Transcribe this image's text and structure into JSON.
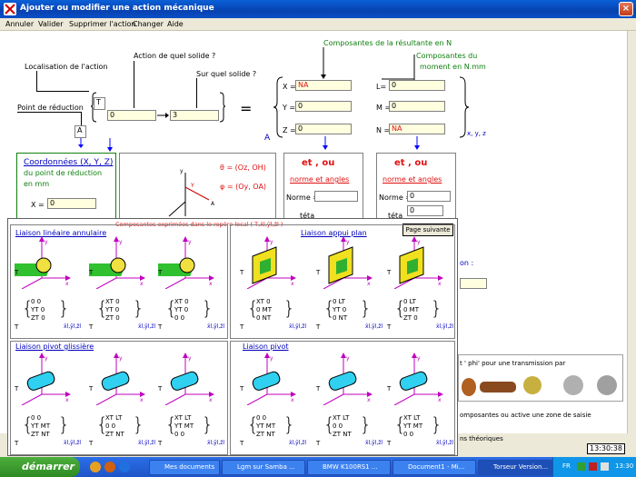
{
  "window": {
    "title": "Ajouter ou modifier une action mécanique"
  },
  "menu": [
    "Annuler",
    "Valider",
    "Supprimer l'action",
    "Changer",
    "Aide"
  ],
  "labels": {
    "localisation": "Localisation de l'action",
    "point_reduction": "Point de réduction",
    "action_solide": "Action de quel solide ?",
    "sur_solide": "Sur quel solide ?",
    "composantes_resultante": "Composantes de la résultante en N",
    "composantes_moment_1": "Composantes du",
    "composantes_moment_2": "moment en N.mm",
    "coord_1": "Coordonnées (X, Y, Z)",
    "coord_2": "du point de réduction",
    "coord_3": "en mm",
    "et_ou": "et , ou",
    "norme_angles": "norme et angles",
    "norme": "Norme =",
    "teta": "téta",
    "x_eq": "X =",
    "basis": "x, y, z",
    "A": "A",
    "T": "T",
    "equals": "="
  },
  "fields": {
    "localisation": "T",
    "point": "A",
    "solide1": "0",
    "solide2": "3",
    "X": "NA",
    "Y": "0",
    "Z": "0",
    "L": "0",
    "M": "0",
    "N": "NA",
    "coordX": "0",
    "norme2": "0",
    "teta2": "0"
  },
  "rowlabels": {
    "X": "X =",
    "Y": "Y =",
    "Z": "Z =",
    "L": "L=",
    "M": "M =",
    "N": "N ="
  },
  "angles": {
    "theta": "θ = (Oz, OH)",
    "phi": "φ = (Oy, OA)"
  },
  "overlay": {
    "header": "Composantes exprimées dans le repère local ( T,x̄l,ȳl,z̄l )",
    "next_button": "Page suivante",
    "q1": "Liaison linéaire annulaire",
    "q2": "Liaison appui plan",
    "q3": "Liaison pivot glissière",
    "q4": "Liaison pivot",
    "matrices": {
      "m1": [
        "0  0",
        "YT 0",
        "ZT 0"
      ],
      "m2": [
        "XT 0",
        "YT 0",
        "ZT 0"
      ],
      "m3": [
        "XT 0",
        "YT 0",
        "0  0"
      ],
      "m4": [
        "XT 0",
        "0  MT",
        "0  NT"
      ],
      "m5": [
        "0  LT",
        "YT 0",
        "0  NT"
      ],
      "m6": [
        "0  LT",
        "0  MT",
        "ZT 0"
      ],
      "m7": [
        "0  0",
        "YT MT",
        "ZT NT"
      ],
      "m8": [
        "XT LT",
        "0  0",
        "ZT NT"
      ],
      "m9": [
        "XT LT",
        "YT MT",
        "0  0"
      ],
      "m10": [
        "0  0",
        "YT MT",
        "ZT NT"
      ],
      "m11": [
        "XT LT",
        "0  0",
        "ZT NT"
      ],
      "m12": [
        "XT LT",
        "YT MT",
        "0  0"
      ]
    },
    "subscript": "x̄l,ȳl,z̄l",
    "axis": {
      "y": "yl",
      "x": "xl",
      "z": "zl"
    }
  },
  "behind": {
    "phi_text": "t ' phi' pour une transmission par",
    "composantes_text": "omposantes ou active une zone de saisie",
    "theoriques": "ns théoriques",
    "on": "on :",
    "clock": "13:30:38"
  },
  "taskbar": {
    "start": "démarrer",
    "items": [
      "Mes documents",
      "Lgm sur Samba ...",
      "BMW K100RS1 ...",
      "Document1 - Mi...",
      "Torseur Version..."
    ],
    "lang": "FR",
    "time": "13:30"
  },
  "colors": {
    "accent": "#0842b0",
    "green": "#108010",
    "blue": "#0000c0",
    "red": "#e01010",
    "field": "#ffffe0"
  }
}
